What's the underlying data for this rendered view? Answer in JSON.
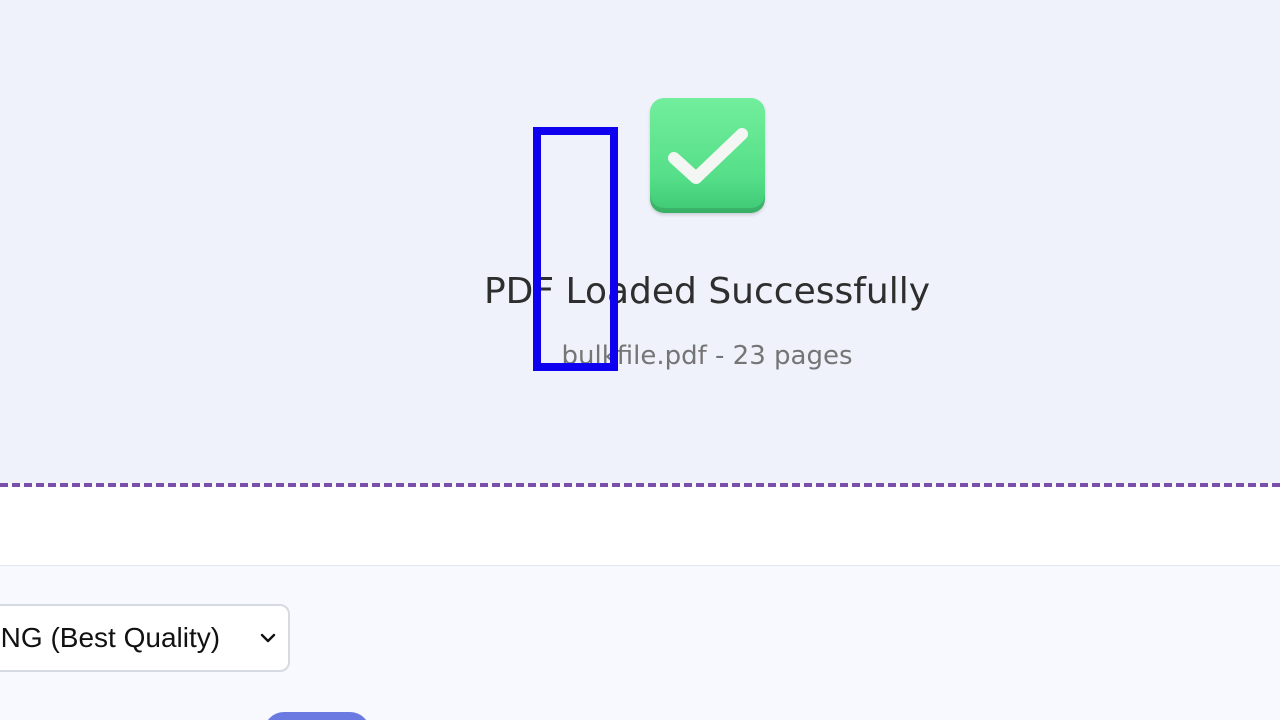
{
  "upload": {
    "status_title": "PDF Loaded Successfully",
    "file_info": "bulkfile.pdf - 23 pages",
    "status_icon": "check-mark-button-icon"
  },
  "options": {
    "format_select": {
      "selected": "PNG (Best Quality)"
    }
  },
  "colors": {
    "dropzone_bg": "#eff1fb",
    "dashed_border": "#7b4fa8",
    "success_green": "#5ee38f",
    "annotation_box": "#1000f0",
    "button_accent": "#6a7ae0"
  }
}
